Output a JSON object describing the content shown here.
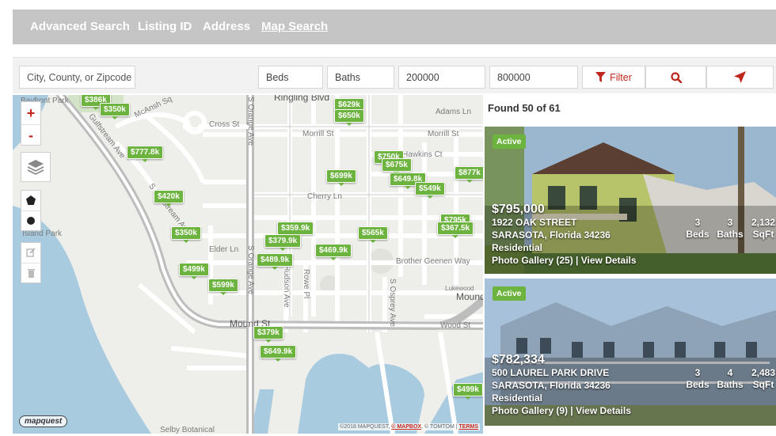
{
  "tabs": [
    {
      "label": "Advanced Search",
      "active": false
    },
    {
      "label": "Listing ID",
      "active": false
    },
    {
      "label": "Address",
      "active": false
    },
    {
      "label": "Map Search",
      "active": true
    }
  ],
  "search": {
    "location_placeholder": "City, County, or Zipcode",
    "beds_label": "Beds",
    "baths_label": "Baths",
    "min_price": "200000",
    "max_price": "800000",
    "filter_label": "Filter",
    "search_icon": "search-icon",
    "locate_icon": "locate-arrow-icon"
  },
  "map": {
    "zoom_in": "+",
    "zoom_out": "-",
    "streets": {
      "ringling": "Ringling Blvd",
      "cross": "Cross St",
      "morrill1": "Morrill St",
      "morrill2": "Morrill St",
      "adams": "Adams Ln",
      "hawkins": "Hawkins Ct",
      "cherry": "Cherry Ln",
      "elder": "Elder Ln",
      "brother": "Brother Geenen Way",
      "mound": "Mound St",
      "mound2": "Mound",
      "wood": "Wood St",
      "orange1": "S Orange Ave",
      "orange2": "S Orange Ave",
      "osprey": "S Osprey Ave",
      "hudson": "Hudson Ave",
      "rowe": "Rowe Pl",
      "gulfstream1": "Gulfstream Ave",
      "gulfstream2": "S Gulfstream Ave",
      "mcansh": "McAnsh Sq",
      "bayfront": "Bayfront Park",
      "island": "Island Park",
      "lukewood": "Lukewood",
      "selby": "Selby Botanical"
    },
    "pins": [
      {
        "label": "$386k"
      },
      {
        "label": "$350k"
      },
      {
        "label": "$777.8k"
      },
      {
        "label": "$420k"
      },
      {
        "label": "$350k"
      },
      {
        "label": "$499k"
      },
      {
        "label": "$599k"
      },
      {
        "label": "$629k"
      },
      {
        "label": "$650k"
      },
      {
        "label": "$699k"
      },
      {
        "label": "$750k"
      },
      {
        "label": "$675k"
      },
      {
        "label": "$649.8k"
      },
      {
        "label": "$549k"
      },
      {
        "label": "$877k"
      },
      {
        "label": "$795k"
      },
      {
        "label": "$367.5k"
      },
      {
        "label": "$565k"
      },
      {
        "label": "$359.9k"
      },
      {
        "label": "$379.9k"
      },
      {
        "label": "$469.9k"
      },
      {
        "label": "$489.9k"
      },
      {
        "label": "$379k"
      },
      {
        "label": "$649.9k"
      },
      {
        "label": "$499k"
      }
    ],
    "logo": "mapquest",
    "attribution": "©2018 MAPQUEST, ",
    "mapbox": "© MAPBOX",
    "tomtom": ", © TOMTOM | ",
    "terms": "TERMS"
  },
  "results": {
    "found": "Found 50 of 61",
    "listings": [
      {
        "status": "Active",
        "price": "$795,000",
        "address": "1922 OAK STREET",
        "city": "SARASOTA, Florida 34236",
        "type": "Residential",
        "gallery": "Photo Gallery (25)",
        "sep": " | ",
        "details": "View Details",
        "beds": "3",
        "beds_label": "Beds",
        "baths": "3",
        "baths_label": "Baths",
        "sqft": "2,132",
        "sqft_label": "SqFt"
      },
      {
        "status": "Active",
        "price": "$782,334",
        "address": "500 LAUREL PARK DRIVE",
        "city": "SARASOTA, Florida 34236",
        "type": "Residential",
        "gallery": "Photo Gallery (9)",
        "sep": " | ",
        "details": "View Details",
        "beds": "3",
        "beds_label": "Beds",
        "baths": "4",
        "baths_label": "Baths",
        "sqft": "2,483",
        "sqft_label": "SqFt"
      }
    ]
  },
  "colors": {
    "accent_red": "#c0271c",
    "pin_green": "#6db33f",
    "tab_bar": "#c5c5c5"
  }
}
